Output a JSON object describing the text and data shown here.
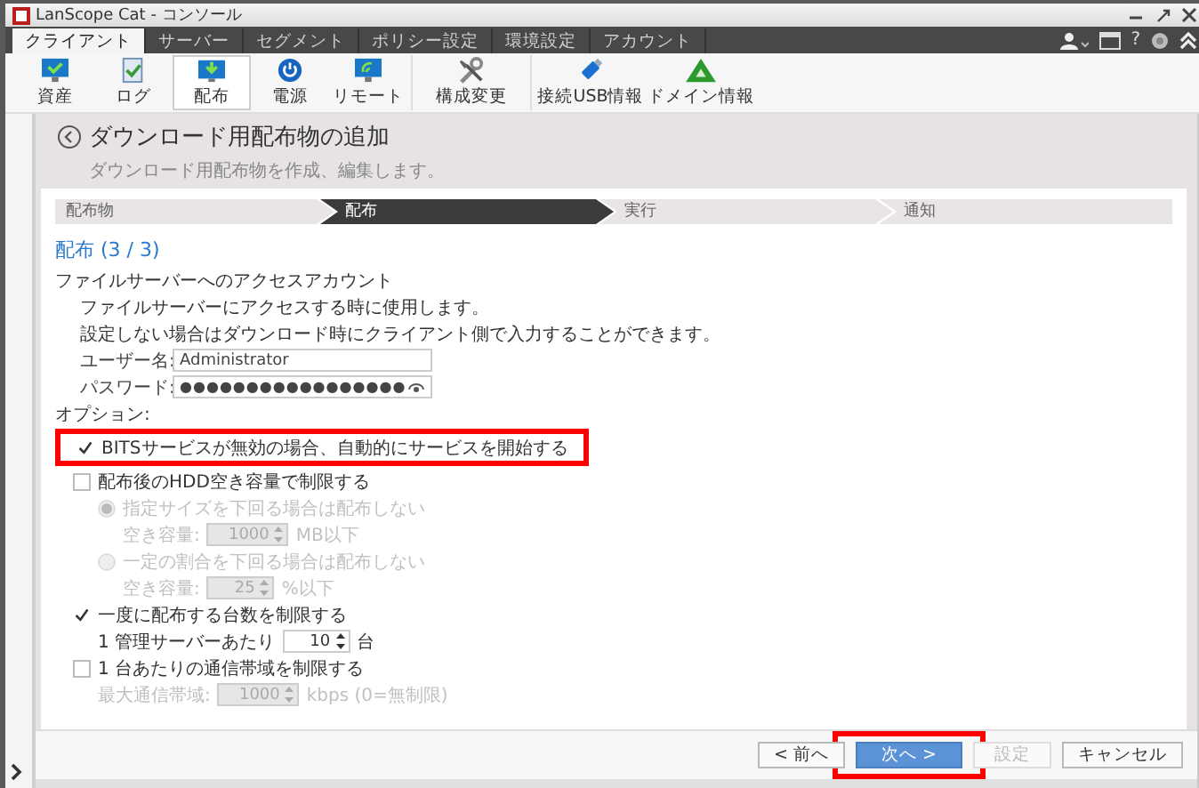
{
  "window": {
    "title": "LanScope Cat - コンソール"
  },
  "tabs": [
    {
      "label": "クライアント",
      "selected": true
    },
    {
      "label": "サーバー",
      "selected": false
    },
    {
      "label": "セグメント",
      "selected": false
    },
    {
      "label": "ポリシー設定",
      "selected": false
    },
    {
      "label": "環境設定",
      "selected": false
    },
    {
      "label": "アカウント",
      "selected": false
    }
  ],
  "help_button": "?",
  "toolbar": {
    "groups": [
      {
        "items": [
          {
            "label": "資産",
            "selected": false
          },
          {
            "label": "ログ",
            "selected": false
          },
          {
            "label": "配布",
            "selected": true
          },
          {
            "label": "電源",
            "selected": false
          },
          {
            "label": "リモート",
            "selected": false
          }
        ]
      },
      {
        "items": [
          {
            "label": "構成変更",
            "selected": false
          }
        ]
      },
      {
        "items": [
          {
            "label": "接続USB情報",
            "selected": false
          },
          {
            "label": "ドメイン情報",
            "selected": false
          }
        ]
      }
    ]
  },
  "page": {
    "title": "ダウンロード用配布物の追加",
    "subtitle": "ダウンロード用配布物を作成、編集します。"
  },
  "steps": [
    {
      "label": "配布物",
      "selected": false
    },
    {
      "label": "配布",
      "selected": true
    },
    {
      "label": "実行",
      "selected": false
    },
    {
      "label": "通知",
      "selected": false
    }
  ],
  "form": {
    "section_title": "配布 (3 / 3)",
    "account_heading": "ファイルサーバーへのアクセスアカウント",
    "notes": [
      "ファイルサーバーにアクセスする時に使用します。",
      "設定しない場合はダウンロード時にクライアント側で入力することができます。"
    ],
    "username": {
      "label": "ユーザー名:",
      "value": "Administrator"
    },
    "password": {
      "label": "パスワード:",
      "value": "●●●●●●●●●●●●●●●●●"
    },
    "options_label": "オプション:",
    "options": [
      {
        "kind": "checkbox",
        "label": "BITSサービスが無効の場合、自動的にサービスを開始する",
        "checked": true,
        "highlighted": true
      },
      {
        "kind": "checkbox",
        "label": "配布後のHDD空き容量で制限する",
        "checked": false,
        "children": [
          {
            "kind": "radio",
            "label": "指定サイズを下回る場合は配布しない",
            "selected": true,
            "disabled": true,
            "children": [
              {
                "kind": "spin",
                "label": "空き容量:",
                "value": "1000",
                "unit": "MB以下",
                "disabled": true
              }
            ]
          },
          {
            "kind": "radio",
            "label": "一定の割合を下回る場合は配布しない",
            "selected": false,
            "disabled": true,
            "children": [
              {
                "kind": "spin",
                "label": "空き容量:",
                "value": "25",
                "unit": "%以下",
                "disabled": true
              }
            ]
          }
        ]
      },
      {
        "kind": "checkbox",
        "label": "一度に配布する台数を制限する",
        "checked": true,
        "children": [
          {
            "kind": "spin",
            "label": "1 管理サーバーあたり",
            "value": "10",
            "unit": "台",
            "disabled": false
          }
        ]
      },
      {
        "kind": "checkbox",
        "label": "1 台あたりの通信帯域を制限する",
        "checked": false,
        "children": [
          {
            "kind": "spin",
            "label": "最大通信帯域:",
            "value": "1000",
            "unit": "kbps (0=無制限)",
            "disabled": true
          }
        ]
      }
    ]
  },
  "buttons": [
    {
      "label": "< 前へ",
      "primary": false,
      "disabled": false,
      "highlighted": false
    },
    {
      "label": "次へ >",
      "primary": true,
      "disabled": false,
      "highlighted": true
    },
    {
      "label": "設定",
      "primary": false,
      "disabled": true,
      "highlighted": false
    },
    {
      "label": "キャンセル",
      "primary": false,
      "disabled": false,
      "highlighted": false
    }
  ]
}
